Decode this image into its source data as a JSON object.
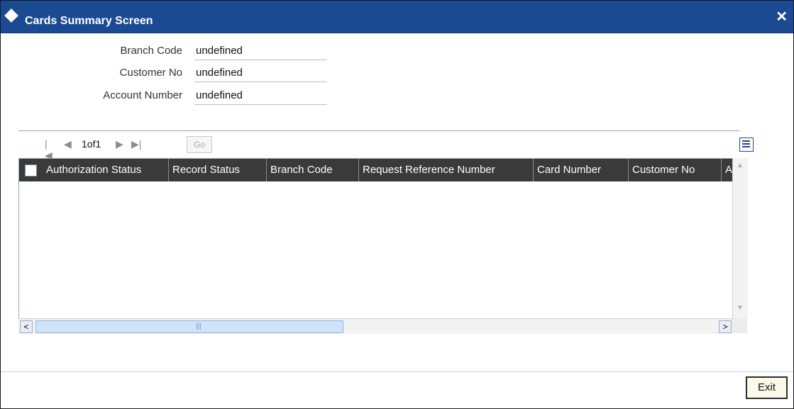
{
  "window": {
    "title": "Cards Summary Screen",
    "close_glyph": "✕"
  },
  "fields": [
    {
      "label": "Branch Code",
      "value": "undefined"
    },
    {
      "label": "Customer No",
      "value": "undefined"
    },
    {
      "label": "Account Number",
      "value": "undefined"
    }
  ],
  "pager": {
    "first": "|◀",
    "prev": "◀",
    "page_text": "1of1",
    "next": "▶",
    "last": "▶|",
    "go_label": "Go"
  },
  "table": {
    "columns": [
      "Authorization Status",
      "Record Status",
      "Branch Code",
      "Request Reference Number",
      "Card Number",
      "Customer No",
      "Ac"
    ],
    "rows": []
  },
  "scroll": {
    "up": "▲",
    "down": "▼",
    "left": "<",
    "right": ">",
    "grip": "|||"
  },
  "footer": {
    "exit_label": "Exit"
  },
  "colors": {
    "titlebar": "#1b4a93",
    "header": "#3a3a3a",
    "exit_bg": "#fdf9e9"
  }
}
